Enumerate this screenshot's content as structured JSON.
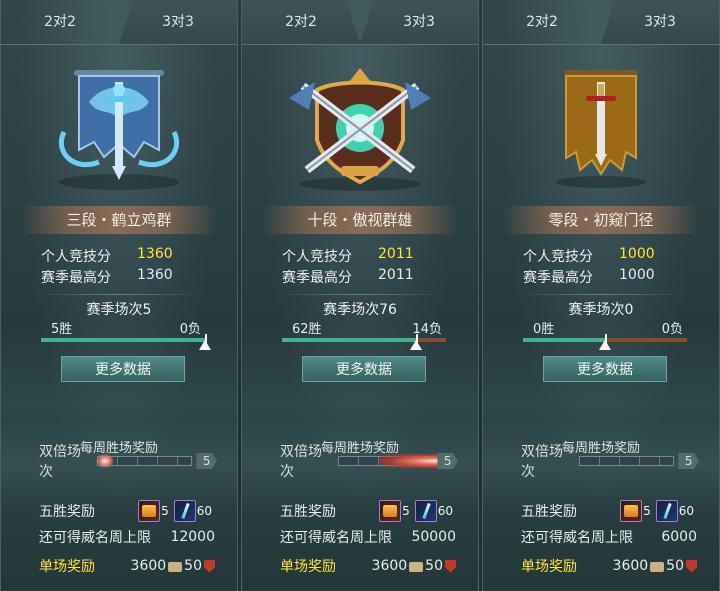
{
  "cards": [
    {
      "tabs": [
        "2对2",
        "3对3"
      ],
      "active_tab": 1,
      "rank_title": "三段・鹤立鸡群",
      "emblem": "blue-dragon-banner-icon",
      "stats": [
        {
          "label": "个人竞技分",
          "value": "1360"
        },
        {
          "label": "赛季最高分",
          "value": "1360"
        }
      ],
      "season_matches": "赛季场次5",
      "wins": "5胜",
      "losses": "0负",
      "win_fraction": 1.0,
      "more_button": "更多数据",
      "weekly_title": "每周胜场奖励",
      "double_label": "双倍场次",
      "double_count": "5",
      "five_win_label": "五胜奖励",
      "five_win_items": [
        {
          "icon": "treasure-box-icon",
          "count": "5"
        },
        {
          "icon": "blue-sword-icon",
          "count": "60"
        }
      ],
      "fame_label": "还可得威名周上限",
      "fame_value": "12000",
      "single_label": "单场奖励",
      "single_coins": "3600",
      "single_fame": "50"
    },
    {
      "tabs": [
        "2对2",
        "3对3"
      ],
      "active_tab": 0,
      "rank_title": "十段・傲视群雄",
      "emblem": "crossed-swords-shield-icon",
      "stats": [
        {
          "label": "个人竞技分",
          "value": "2011"
        },
        {
          "label": "赛季最高分",
          "value": "2011"
        }
      ],
      "season_matches": "赛季场次76",
      "wins": "62胜",
      "losses": "14负",
      "win_fraction": 0.816,
      "more_button": "更多数据",
      "weekly_title": "每周胜场奖励",
      "double_label": "双倍场次",
      "double_count": "5",
      "five_win_label": "五胜奖励",
      "five_win_items": [
        {
          "icon": "treasure-box-icon",
          "count": "5"
        },
        {
          "icon": "blue-sword-icon",
          "count": "60"
        }
      ],
      "fame_label": "还可得威名周上限",
      "fame_value": "50000",
      "single_label": "单场奖励",
      "single_coins": "3600",
      "single_fame": "50"
    },
    {
      "tabs": [
        "2对2",
        "3对3"
      ],
      "active_tab": 1,
      "rank_title": "零段・初窥门径",
      "emblem": "brown-banner-sword-icon",
      "stats": [
        {
          "label": "个人竞技分",
          "value": "1000"
        },
        {
          "label": "赛季最高分",
          "value": "1000"
        }
      ],
      "season_matches": "赛季场次0",
      "wins": "0胜",
      "losses": "0负",
      "win_fraction": 0.5,
      "more_button": "更多数据",
      "weekly_title": "每周胜场奖励",
      "double_label": "双倍场次",
      "double_count": "5",
      "five_win_label": "五胜奖励",
      "five_win_items": [
        {
          "icon": "treasure-box-icon",
          "count": "5"
        },
        {
          "icon": "blue-sword-icon",
          "count": "60"
        }
      ],
      "fame_label": "还可得威名周上限",
      "fame_value": "6000",
      "single_label": "单场奖励",
      "single_coins": "3600",
      "single_fame": "50"
    }
  ],
  "colors": {
    "highlight_yellow": "#ffe43c",
    "win_green": "#3fb38b",
    "loss_red": "#8a4a2c"
  }
}
